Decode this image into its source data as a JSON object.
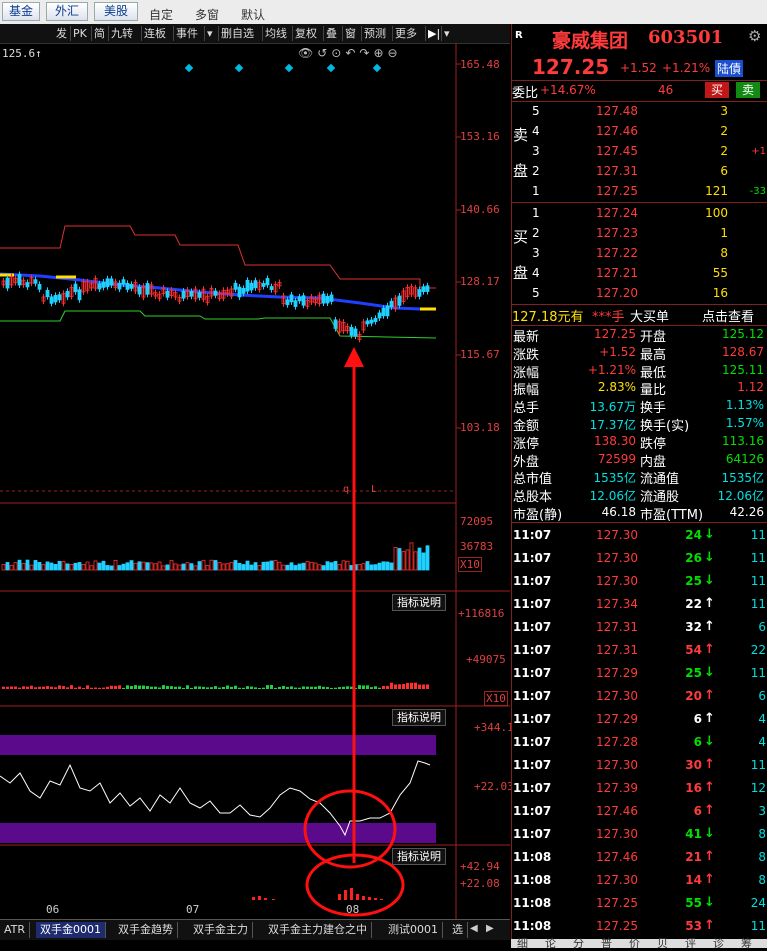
{
  "topbar": {
    "buttons": [
      "基金",
      "外汇",
      "美股"
    ],
    "items": [
      "自定",
      "多窗",
      "默认"
    ]
  },
  "toolbar": {
    "items": [
      "发",
      "PK",
      "简",
      "九转",
      "连板",
      "事件",
      "▾",
      "删自选",
      "均线",
      "复权",
      "叠",
      "窗",
      "预测",
      "更多"
    ],
    "price_marker": "125.6↑"
  },
  "chart": {
    "price_axis": [
      "165.48",
      "153.16",
      "140.66",
      "128.17",
      "115.67",
      "103.18"
    ],
    "volume_axis": [
      "72095",
      "36783",
      "X10"
    ],
    "ind1_axis": [
      "+116816",
      "+49075",
      "X10"
    ],
    "ind2_axis": [
      "+344.1",
      "+22.03"
    ],
    "ind3_axis": [
      "+42.94",
      "+22.08"
    ],
    "ind_button": "指标说明",
    "x_labels": [
      "06",
      "07",
      "08"
    ],
    "marks": [
      "q",
      "L"
    ]
  },
  "bottom_tabs": [
    "ATR",
    "双手金0001",
    "双手金趋势",
    "双手金主力",
    "双手金主力建仓之中",
    "测试0001",
    "选"
  ],
  "bottom_tab_selected": 1,
  "quote": {
    "r_badge": "R",
    "name": "豪威集团",
    "code": "603501",
    "price": "127.25",
    "change": "+1.52",
    "change_pct": "+1.21%",
    "tag": "陆債",
    "weibi_label": "委比",
    "weibi": "+14.67%",
    "weicha": "46",
    "buy_btn": "买",
    "sell_btn": "卖",
    "sell_label": [
      "卖",
      "盘"
    ],
    "buy_label": [
      "买",
      "盘"
    ],
    "sells": [
      {
        "lvl": "5",
        "price": "127.48",
        "vol": "3",
        "chg": ""
      },
      {
        "lvl": "4",
        "price": "127.46",
        "vol": "2",
        "chg": ""
      },
      {
        "lvl": "3",
        "price": "127.45",
        "vol": "2",
        "chg": "+1"
      },
      {
        "lvl": "2",
        "price": "127.31",
        "vol": "6",
        "chg": ""
      },
      {
        "lvl": "1",
        "price": "127.25",
        "vol": "121",
        "chg": "-33"
      }
    ],
    "buys": [
      {
        "lvl": "1",
        "price": "127.24",
        "vol": "100"
      },
      {
        "lvl": "2",
        "price": "127.23",
        "vol": "1"
      },
      {
        "lvl": "3",
        "price": "127.22",
        "vol": "8"
      },
      {
        "lvl": "4",
        "price": "127.21",
        "vol": "55"
      },
      {
        "lvl": "5",
        "price": "127.20",
        "vol": "16"
      }
    ],
    "bigorder": {
      "price": "127.18元有",
      "stars": "***手",
      "label": "大买单",
      "link": "点击查看"
    },
    "stats": [
      {
        "l1": "最新",
        "v1": "127.25",
        "c1": "red",
        "l2": "开盘",
        "v2": "125.12",
        "c2": "green"
      },
      {
        "l1": "涨跌",
        "v1": "+1.52",
        "c1": "red",
        "l2": "最高",
        "v2": "128.67",
        "c2": "red"
      },
      {
        "l1": "涨幅",
        "v1": "+1.21%",
        "c1": "red",
        "l2": "最低",
        "v2": "125.11",
        "c2": "green"
      },
      {
        "l1": "振幅",
        "v1": "2.83%",
        "c1": "yel",
        "l2": "量比",
        "v2": "1.12",
        "c2": "red"
      },
      {
        "l1": "总手",
        "v1": "13.67万",
        "c1": "cyan",
        "l2": "换手",
        "v2": "1.13%",
        "c2": "cyan"
      },
      {
        "l1": "金额",
        "v1": "17.37亿",
        "c1": "cyan",
        "l2": "换手(实)",
        "v2": "1.57%",
        "c2": "cyan"
      },
      {
        "l1": "涨停",
        "v1": "138.30",
        "c1": "red",
        "l2": "跌停",
        "v2": "113.16",
        "c2": "green"
      },
      {
        "l1": "外盘",
        "v1": "72599",
        "c1": "red",
        "l2": "内盘",
        "v2": "64126",
        "c2": "green"
      },
      {
        "l1": "总市值",
        "v1": "1535亿",
        "c1": "cyan",
        "l2": "流通值",
        "v2": "1535亿",
        "c2": "cyan"
      },
      {
        "l1": "总股本",
        "v1": "12.06亿",
        "c1": "cyan",
        "l2": "流通股",
        "v2": "12.06亿",
        "c2": "cyan"
      },
      {
        "l1": "市盈(静)",
        "v1": "46.18",
        "c1": "wht",
        "l2": "市盈(TTM)",
        "v2": "42.26",
        "c2": "wht"
      }
    ],
    "ticks": [
      {
        "t": "11:07",
        "p": "127.30",
        "v": "24",
        "d": "down",
        "n": "11"
      },
      {
        "t": "11:07",
        "p": "127.30",
        "v": "26",
        "d": "down",
        "n": "11"
      },
      {
        "t": "11:07",
        "p": "127.30",
        "v": "25",
        "d": "down",
        "n": "11"
      },
      {
        "t": "11:07",
        "p": "127.34",
        "v": "22",
        "d": "upw",
        "n": "11"
      },
      {
        "t": "11:07",
        "p": "127.31",
        "v": "32",
        "d": "upw",
        "n": "6"
      },
      {
        "t": "11:07",
        "p": "127.31",
        "v": "54",
        "d": "up",
        "n": "22"
      },
      {
        "t": "11:07",
        "p": "127.29",
        "v": "25",
        "d": "down",
        "n": "11"
      },
      {
        "t": "11:07",
        "p": "127.30",
        "v": "20",
        "d": "up",
        "n": "6"
      },
      {
        "t": "11:07",
        "p": "127.29",
        "v": "6",
        "d": "upw",
        "n": "4"
      },
      {
        "t": "11:07",
        "p": "127.28",
        "v": "6",
        "d": "down",
        "n": "4"
      },
      {
        "t": "11:07",
        "p": "127.30",
        "v": "30",
        "d": "up",
        "n": "11"
      },
      {
        "t": "11:07",
        "p": "127.39",
        "v": "16",
        "d": "up",
        "n": "12"
      },
      {
        "t": "11:07",
        "p": "127.46",
        "v": "6",
        "d": "up",
        "n": "3"
      },
      {
        "t": "11:07",
        "p": "127.30",
        "v": "41",
        "d": "down",
        "n": "8"
      },
      {
        "t": "11:08",
        "p": "127.46",
        "v": "21",
        "d": "up",
        "n": "8"
      },
      {
        "t": "11:08",
        "p": "127.30",
        "v": "14",
        "d": "up",
        "n": "8"
      },
      {
        "t": "11:08",
        "p": "127.25",
        "v": "55",
        "d": "down",
        "n": "24"
      },
      {
        "t": "11:08",
        "p": "127.25",
        "v": "53",
        "d": "up",
        "n": "11"
      }
    ],
    "bottom_tabs": [
      "细",
      "论",
      "分",
      "普",
      "价",
      "贝",
      "评",
      "诊",
      "筹"
    ]
  }
}
